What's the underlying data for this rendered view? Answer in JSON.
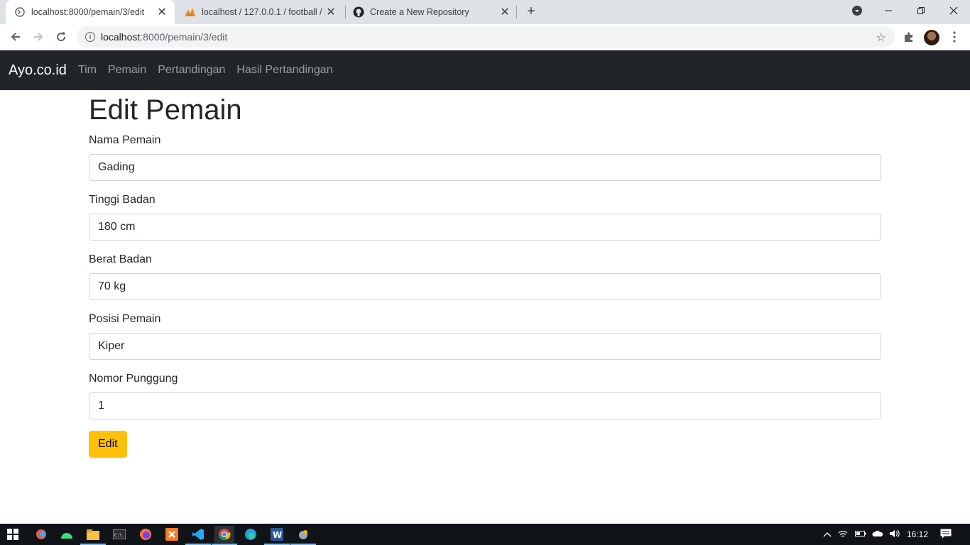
{
  "browser": {
    "tabs": [
      {
        "title": "localhost:8000/pemain/3/edit",
        "active": true
      },
      {
        "title": "localhost / 127.0.0.1 / football / h",
        "active": false
      },
      {
        "title": "Create a New Repository",
        "active": false
      }
    ],
    "url": {
      "host": "localhost",
      "path": ":8000/pemain/3/edit"
    }
  },
  "navbar": {
    "brand": "Ayo.co.id",
    "links": [
      "Tim",
      "Pemain",
      "Pertandingan",
      "Hasil Pertandingan"
    ]
  },
  "page": {
    "title": "Edit Pemain",
    "fields": [
      {
        "label": "Nama Pemain",
        "value": "Gading"
      },
      {
        "label": "Tinggi Badan",
        "value": "180 cm"
      },
      {
        "label": "Berat Badan",
        "value": "70 kg"
      },
      {
        "label": "Posisi Pemain",
        "value": "Kiper"
      },
      {
        "label": "Nomor Punggung",
        "value": "1"
      }
    ],
    "submit_label": "Edit"
  },
  "taskbar": {
    "clock": "16:12"
  },
  "colors": {
    "navbar_bg": "#212529",
    "button_warning": "#ffc107"
  }
}
